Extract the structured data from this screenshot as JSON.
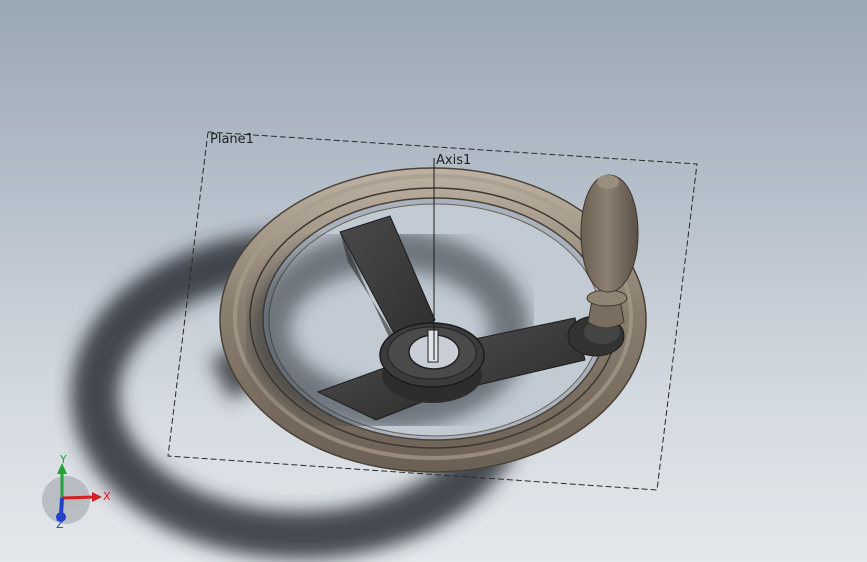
{
  "viewport": {
    "plane_label": "Plane1",
    "axis_label": "Axis1"
  },
  "triad": {
    "x_label": "X",
    "y_label": "Y",
    "z_label": "Z",
    "x_color": "#d42020",
    "y_color": "#22a33a",
    "z_color": "#2240c8"
  },
  "model": {
    "part_color": "#85796b",
    "spoke_color": "#3c3c3c"
  }
}
